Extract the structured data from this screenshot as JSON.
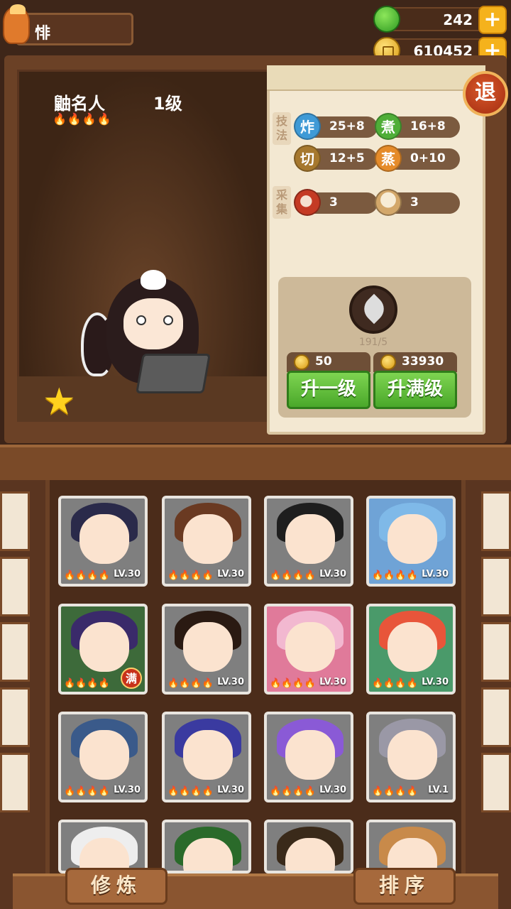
{
  "player": {
    "name": "悱"
  },
  "resources": {
    "gems": "242",
    "coins": "610452",
    "add_symbol": "+"
  },
  "chef": {
    "name": "鼬名人",
    "level": "1级",
    "flames": "🔥🔥🔥🔥"
  },
  "skills": {
    "label": "技法",
    "items": [
      {
        "glyph": "炸",
        "value": "25+8",
        "color": "#3f9ad6"
      },
      {
        "glyph": "煮",
        "value": "16+8",
        "color": "#4fae38"
      },
      {
        "glyph": "切",
        "value": "12+5",
        "color": "#a6782e"
      },
      {
        "glyph": "蒸",
        "value": "0+10",
        "color": "#e58b2a"
      }
    ]
  },
  "gather": {
    "label": "采集",
    "items": [
      {
        "icon": "meat-icon",
        "value": "3"
      },
      {
        "icon": "flour-icon",
        "value": "3"
      }
    ]
  },
  "upgrade": {
    "progress": "191/5",
    "one": {
      "cost": "50",
      "label": "升一级"
    },
    "max": {
      "cost": "33930",
      "label": "升满级"
    }
  },
  "quit_label": "退",
  "roster": [
    {
      "level": "LV.30",
      "flames": "🔥🔥🔥🔥",
      "hair": "#2a2a4a",
      "bg": "#7f7f7f"
    },
    {
      "level": "LV.30",
      "flames": "🔥🔥🔥🔥",
      "hair": "#6a3a22",
      "bg": "#7f7f7f"
    },
    {
      "level": "LV.30",
      "flames": "🔥🔥🔥🔥",
      "hair": "#1e1e1e",
      "bg": "#7f7f7f"
    },
    {
      "level": "LV.30",
      "flames": "🔥🔥🔥🔥",
      "hair": "#7fb9e8",
      "bg": "#6fa3d6"
    },
    {
      "level": "满",
      "flames": "🔥🔥🔥🔥",
      "hair": "#3a2a6a",
      "bg": "#3d6a3a",
      "full": true
    },
    {
      "level": "LV.30",
      "flames": "🔥🔥🔥🔥",
      "hair": "#2a1a12",
      "bg": "#7f7f7f"
    },
    {
      "level": "LV.30",
      "flames": "🔥🔥🔥🔥",
      "hair": "#f2b8d0",
      "bg": "#e07a9a"
    },
    {
      "level": "LV.30",
      "flames": "🔥🔥🔥🔥",
      "hair": "#e8553a",
      "bg": "#4a9a6a"
    },
    {
      "level": "LV.30",
      "flames": "🔥🔥🔥🔥",
      "hair": "#3a5a8a",
      "bg": "#7f7f7f"
    },
    {
      "level": "LV.30",
      "flames": "🔥🔥🔥🔥",
      "hair": "#3a3aa0",
      "bg": "#7f7f7f"
    },
    {
      "level": "LV.30",
      "flames": "🔥🔥🔥🔥",
      "hair": "#8a5ad6",
      "bg": "#7f7f7f"
    },
    {
      "level": "LV.1",
      "flames": "🔥🔥🔥🔥",
      "hair": "#9a98a6",
      "bg": "#7f7f7f"
    },
    {
      "level": "",
      "flames": "",
      "hair": "#eeeeee",
      "bg": "#7f7f7f"
    },
    {
      "level": "",
      "flames": "",
      "hair": "#2a6a2a",
      "bg": "#7f7f7f"
    },
    {
      "level": "",
      "flames": "",
      "hair": "#3a2a1a",
      "bg": "#7f7f7f"
    },
    {
      "level": "",
      "flames": "",
      "hair": "#c88a4a",
      "bg": "#7f7f7f"
    }
  ],
  "bottom": {
    "train": "修炼",
    "sort": "排序"
  }
}
